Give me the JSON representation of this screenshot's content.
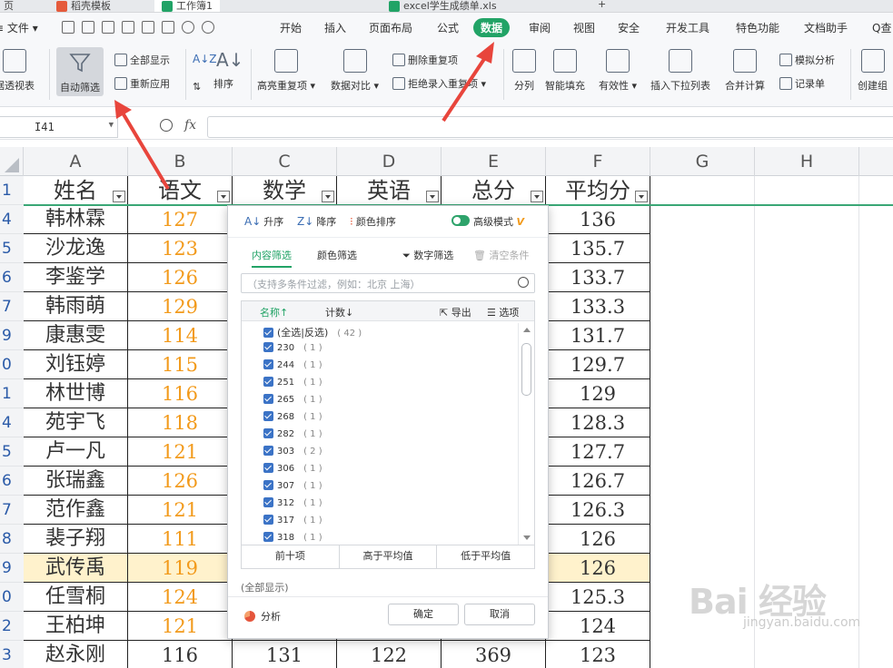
{
  "doc_tabs": [
    {
      "label": "页",
      "color": "#e55b3c"
    },
    {
      "label": "稻壳模板",
      "color": "#e55b3c"
    },
    {
      "label": "工作簿1",
      "color": "#21a366"
    },
    {
      "label": "excel学生成绩单.xls",
      "color": "#21a366"
    },
    {
      "label": "+",
      "color": ""
    }
  ],
  "menu": {
    "file": "文件",
    "items": [
      "开始",
      "插入",
      "页面布局",
      "公式",
      "数据",
      "审阅",
      "视图",
      "安全",
      "开发工具",
      "特色功能",
      "文档助手",
      "Q查"
    ],
    "active_index": 4,
    "active_color": "#21a366"
  },
  "ribbon": {
    "pivot": "据透视表",
    "autofilter": "自动筛选",
    "show_all": "全部显示",
    "reapply": "重新应用",
    "sort": "排序",
    "highlight_dup": "高亮重复项",
    "compare": "数据对比",
    "delete_dup": "删除重复项",
    "reject_dup": "拒绝录入重复项",
    "split": "分列",
    "smart_fill": "智能填充",
    "validity": "有效性",
    "dropdown": "插入下拉列表",
    "consolidate": "合并计算",
    "simulate": "模拟分析",
    "record": "记录单",
    "create_group": "创建组"
  },
  "formula_bar": {
    "name_box": "I41",
    "fx": "fx"
  },
  "columns": [
    "A",
    "B",
    "C",
    "D",
    "E",
    "F",
    "G",
    "H"
  ],
  "headers": [
    "姓名",
    "语文",
    "数学",
    "英语",
    "总分",
    "平均分"
  ],
  "header_row_num": "1",
  "rows": [
    {
      "num": "4",
      "name": "韩林霖",
      "chinese": "127",
      "avg": "136"
    },
    {
      "num": "5",
      "name": "沙龙逸",
      "chinese": "123",
      "avg": "135.7"
    },
    {
      "num": "6",
      "name": "李鉴学",
      "chinese": "126",
      "avg": "133.7"
    },
    {
      "num": "7",
      "name": "韩雨萌",
      "chinese": "129",
      "avg": "133.3"
    },
    {
      "num": "9",
      "name": "康惠雯",
      "chinese": "114",
      "avg": "131.7"
    },
    {
      "num": "0",
      "name": "刘钰婷",
      "chinese": "115",
      "avg": "129.7"
    },
    {
      "num": "1",
      "name": "林世博",
      "chinese": "116",
      "avg": "129"
    },
    {
      "num": "4",
      "name": "苑宇飞",
      "chinese": "118",
      "avg": "128.3"
    },
    {
      "num": "5",
      "name": "卢一凡",
      "chinese": "121",
      "avg": "127.7"
    },
    {
      "num": "6",
      "name": "张瑞鑫",
      "chinese": "126",
      "avg": "126.7"
    },
    {
      "num": "7",
      "name": "范作鑫",
      "chinese": "121",
      "avg": "126.3"
    },
    {
      "num": "8",
      "name": "裴子翔",
      "chinese": "111",
      "avg": "126"
    },
    {
      "num": "9",
      "name": "武传禹",
      "chinese": "119",
      "avg": "126"
    },
    {
      "num": "0",
      "name": "任雪桐",
      "chinese": "124",
      "avg": "125.3"
    },
    {
      "num": "2",
      "name": "王柏坤",
      "chinese": "121",
      "avg": "124"
    },
    {
      "num": "3",
      "name": "赵永刚",
      "chinese": "116",
      "math": "131",
      "english": "122",
      "total": "369",
      "avg": "123"
    }
  ],
  "filter_popup": {
    "asc": "升序",
    "desc": "降序",
    "color_sort": "颜色排序",
    "advanced": "高级模式",
    "tab_content": "内容筛选",
    "tab_color": "颜色筛选",
    "num_filter": "数字筛选",
    "clear": "清空条件",
    "search_placeholder": "（支持多条件过滤，例如：北京  上海）",
    "col_name": "名称↑",
    "col_count": "计数↓",
    "export": "导出",
    "options": "选项",
    "select_all": "(全选|反选)",
    "select_all_count": "( 42 )",
    "items": [
      {
        "value": "230",
        "count": "( 1 )"
      },
      {
        "value": "244",
        "count": "( 1 )"
      },
      {
        "value": "251",
        "count": "( 1 )"
      },
      {
        "value": "265",
        "count": "( 1 )"
      },
      {
        "value": "268",
        "count": "( 1 )"
      },
      {
        "value": "282",
        "count": "( 1 )"
      },
      {
        "value": "303",
        "count": "( 2 )"
      },
      {
        "value": "306",
        "count": "( 1 )"
      },
      {
        "value": "307",
        "count": "( 1 )"
      },
      {
        "value": "312",
        "count": "( 1 )"
      },
      {
        "value": "317",
        "count": "( 1 )"
      },
      {
        "value": "318",
        "count": "( 1 )"
      }
    ],
    "top10": "前十项",
    "above_avg": "高于平均值",
    "below_avg": "低于平均值",
    "show_all_status": "(全部显示)",
    "analyze": "分析",
    "ok": "确定",
    "cancel": "取消"
  },
  "watermark": {
    "main": "Bai 经验",
    "sub": "jingyan.baidu.com"
  }
}
